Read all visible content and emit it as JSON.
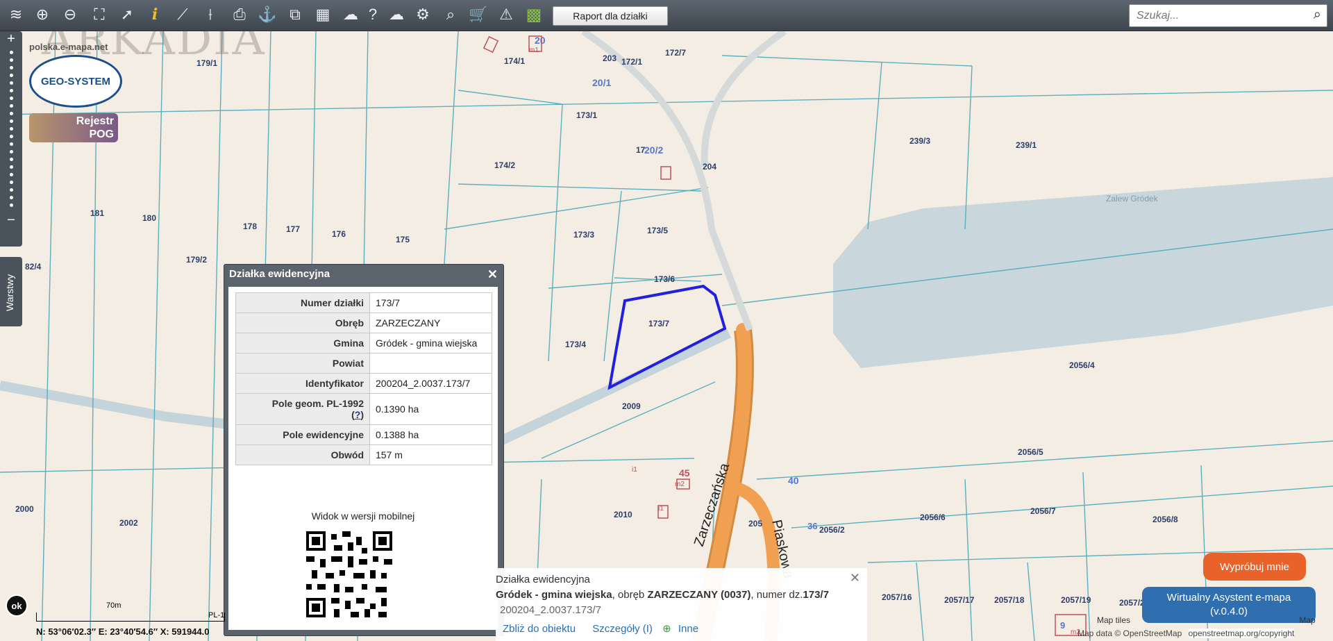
{
  "toolbar": {
    "report_button": "Raport dla działki",
    "search_placeholder": "Szukaj...",
    "tools": [
      "layers-icon",
      "zoom-in-icon",
      "zoom-out-icon",
      "zoom-extent-icon",
      "select-icon",
      "info-icon",
      "measure-length-icon",
      "measure-area-icon",
      "print-icon",
      "mark-icon",
      "export-icon",
      "layout-icon",
      "annotation-icon",
      "help-icon",
      "cloud-icon",
      "settings-icon",
      "locate-icon",
      "cart-icon",
      "warning-icon",
      "color-grid-icon"
    ]
  },
  "sidebar": {
    "zoom_in": "+",
    "zoom_out": "−",
    "layers_label": "Warstwy"
  },
  "logos": {
    "site": "polska.e-mapa.net",
    "geo": "GEO-SYSTEM",
    "pog_line1": "Rejestr",
    "pog_line2": "POG",
    "watermark": "ARKADIA"
  },
  "popup": {
    "title": "Działka ewidencyjna",
    "rows": [
      {
        "key": "Numer działki",
        "value": "173/7"
      },
      {
        "key": "Obręb",
        "value": "ZARZECZANY"
      },
      {
        "key": "Gmina",
        "value": "Gródek - gmina wiejska"
      },
      {
        "key": "Powiat",
        "value": ""
      },
      {
        "key": "Identyfikator",
        "value": "200204_2.0037.173/7"
      },
      {
        "key": "Pole geom. PL-1992",
        "value": "0.1390 ha",
        "help": "?"
      },
      {
        "key": "Pole ewidencyjne",
        "value": "0.1388 ha"
      },
      {
        "key": "Obwód",
        "value": "157 m"
      }
    ],
    "mobile_label": "Widok w wersji mobilnej"
  },
  "info_panel": {
    "title": "Działka ewidencyjna",
    "gmina": "Gródek - gmina wiejska",
    "obreb_prefix": ", obręb ",
    "obreb": "ZARZECZANY (0037)",
    "numer_prefix": ", numer dz.",
    "numer": "173/7",
    "identifier": "200204_2.0037.173/7",
    "link_zoom": "Zbliż do obiektu",
    "link_details": "Szczegóły (I)",
    "link_other": "Inne"
  },
  "buttons": {
    "try_me": "Wypróbuj mnie",
    "assistant": "Wirtualny Asystent e-mapa",
    "assistant_version": "(v.0.4.0)"
  },
  "status": {
    "ok": "ok",
    "coords": "N: 53°06′02.3″  E: 23°40′54.6″  X: 591944.0",
    "scale_label": "70m",
    "crs": "PL-1"
  },
  "attribution": {
    "line1": "Map tiles",
    "line2": "Map data © OpenStreetMap",
    "line3": "openstreetmap.org/copyright",
    "map_suffix": "Map"
  },
  "map_labels": [
    "179/1",
    "174/1",
    "172/1",
    "172/7",
    "203",
    "20/1",
    "173/1",
    "174/2",
    "20/2",
    "17",
    "204",
    "239/3",
    "239/1",
    "Zalew Gródek",
    "181",
    "180",
    "178",
    "177",
    "176",
    "175",
    "173/3",
    "173/5",
    "179/2",
    "82/4",
    "173/6",
    "173/7",
    "173/4",
    "2009",
    "2056/4",
    "2056/5",
    "40",
    "45",
    "i1",
    "2000",
    "2002",
    "2010",
    "36",
    "2056/2",
    "2056/6",
    "2056/7",
    "2056/8",
    "2057/16",
    "2057/17",
    "2057/18",
    "2057/19",
    "2057/20",
    "205",
    "Zarzeczańska",
    "Piaskowa",
    "9",
    "m2",
    "m1",
    "i1",
    "20",
    "m2"
  ],
  "colors": {
    "parcel_line": "#4aa3b4",
    "highlight": "#2020e0",
    "road": "#f0a050",
    "water": "#c9d6dc"
  }
}
